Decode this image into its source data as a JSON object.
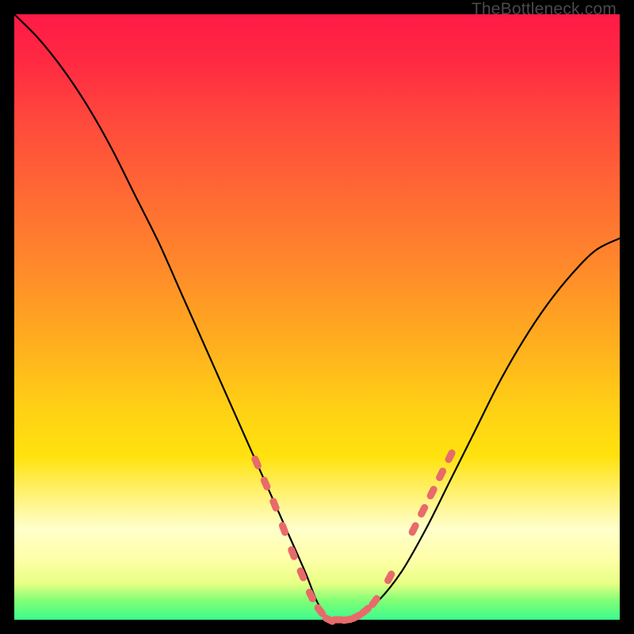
{
  "watermark": "TheBottleneck.com",
  "colors": {
    "background": "#000000",
    "gradient_top": "#ff1a46",
    "gradient_mid": "#ffd015",
    "gradient_pale": "#ffffcb",
    "gradient_bottom": "#3cfb8e",
    "curve_stroke": "#000000",
    "marker_fill": "#e86a6a",
    "marker_stroke": "#c94f4f"
  },
  "chart_data": {
    "type": "line",
    "title": "",
    "xlabel": "",
    "ylabel": "",
    "xlim": [
      0,
      100
    ],
    "ylim": [
      0,
      100
    ],
    "grid": false,
    "legend": false,
    "series": [
      {
        "name": "bottleneck-curve",
        "x": [
          0,
          4,
          8,
          12,
          16,
          20,
          24,
          28,
          32,
          36,
          40,
          44,
          48,
          50,
          52,
          54,
          56,
          60,
          64,
          68,
          72,
          76,
          80,
          84,
          88,
          92,
          96,
          100
        ],
        "y": [
          100,
          96,
          91,
          85,
          78,
          70,
          62,
          53,
          44,
          35,
          26,
          17,
          8,
          3,
          0,
          0,
          0,
          3,
          8,
          15,
          23,
          31,
          39,
          46,
          52,
          57,
          61,
          63
        ]
      }
    ],
    "markers": [
      {
        "x": 40,
        "y": 26
      },
      {
        "x": 41.5,
        "y": 22.5
      },
      {
        "x": 43,
        "y": 19
      },
      {
        "x": 44.5,
        "y": 15
      },
      {
        "x": 46,
        "y": 11
      },
      {
        "x": 47.5,
        "y": 7.5
      },
      {
        "x": 49,
        "y": 4
      },
      {
        "x": 50.5,
        "y": 1.5
      },
      {
        "x": 52,
        "y": 0
      },
      {
        "x": 53.5,
        "y": 0
      },
      {
        "x": 55,
        "y": 0
      },
      {
        "x": 56.5,
        "y": 0.5
      },
      {
        "x": 58,
        "y": 1.5
      },
      {
        "x": 59.5,
        "y": 3
      },
      {
        "x": 62,
        "y": 7
      },
      {
        "x": 66,
        "y": 15
      },
      {
        "x": 67.5,
        "y": 18
      },
      {
        "x": 69,
        "y": 21
      },
      {
        "x": 70.5,
        "y": 24
      },
      {
        "x": 72,
        "y": 27
      }
    ]
  }
}
